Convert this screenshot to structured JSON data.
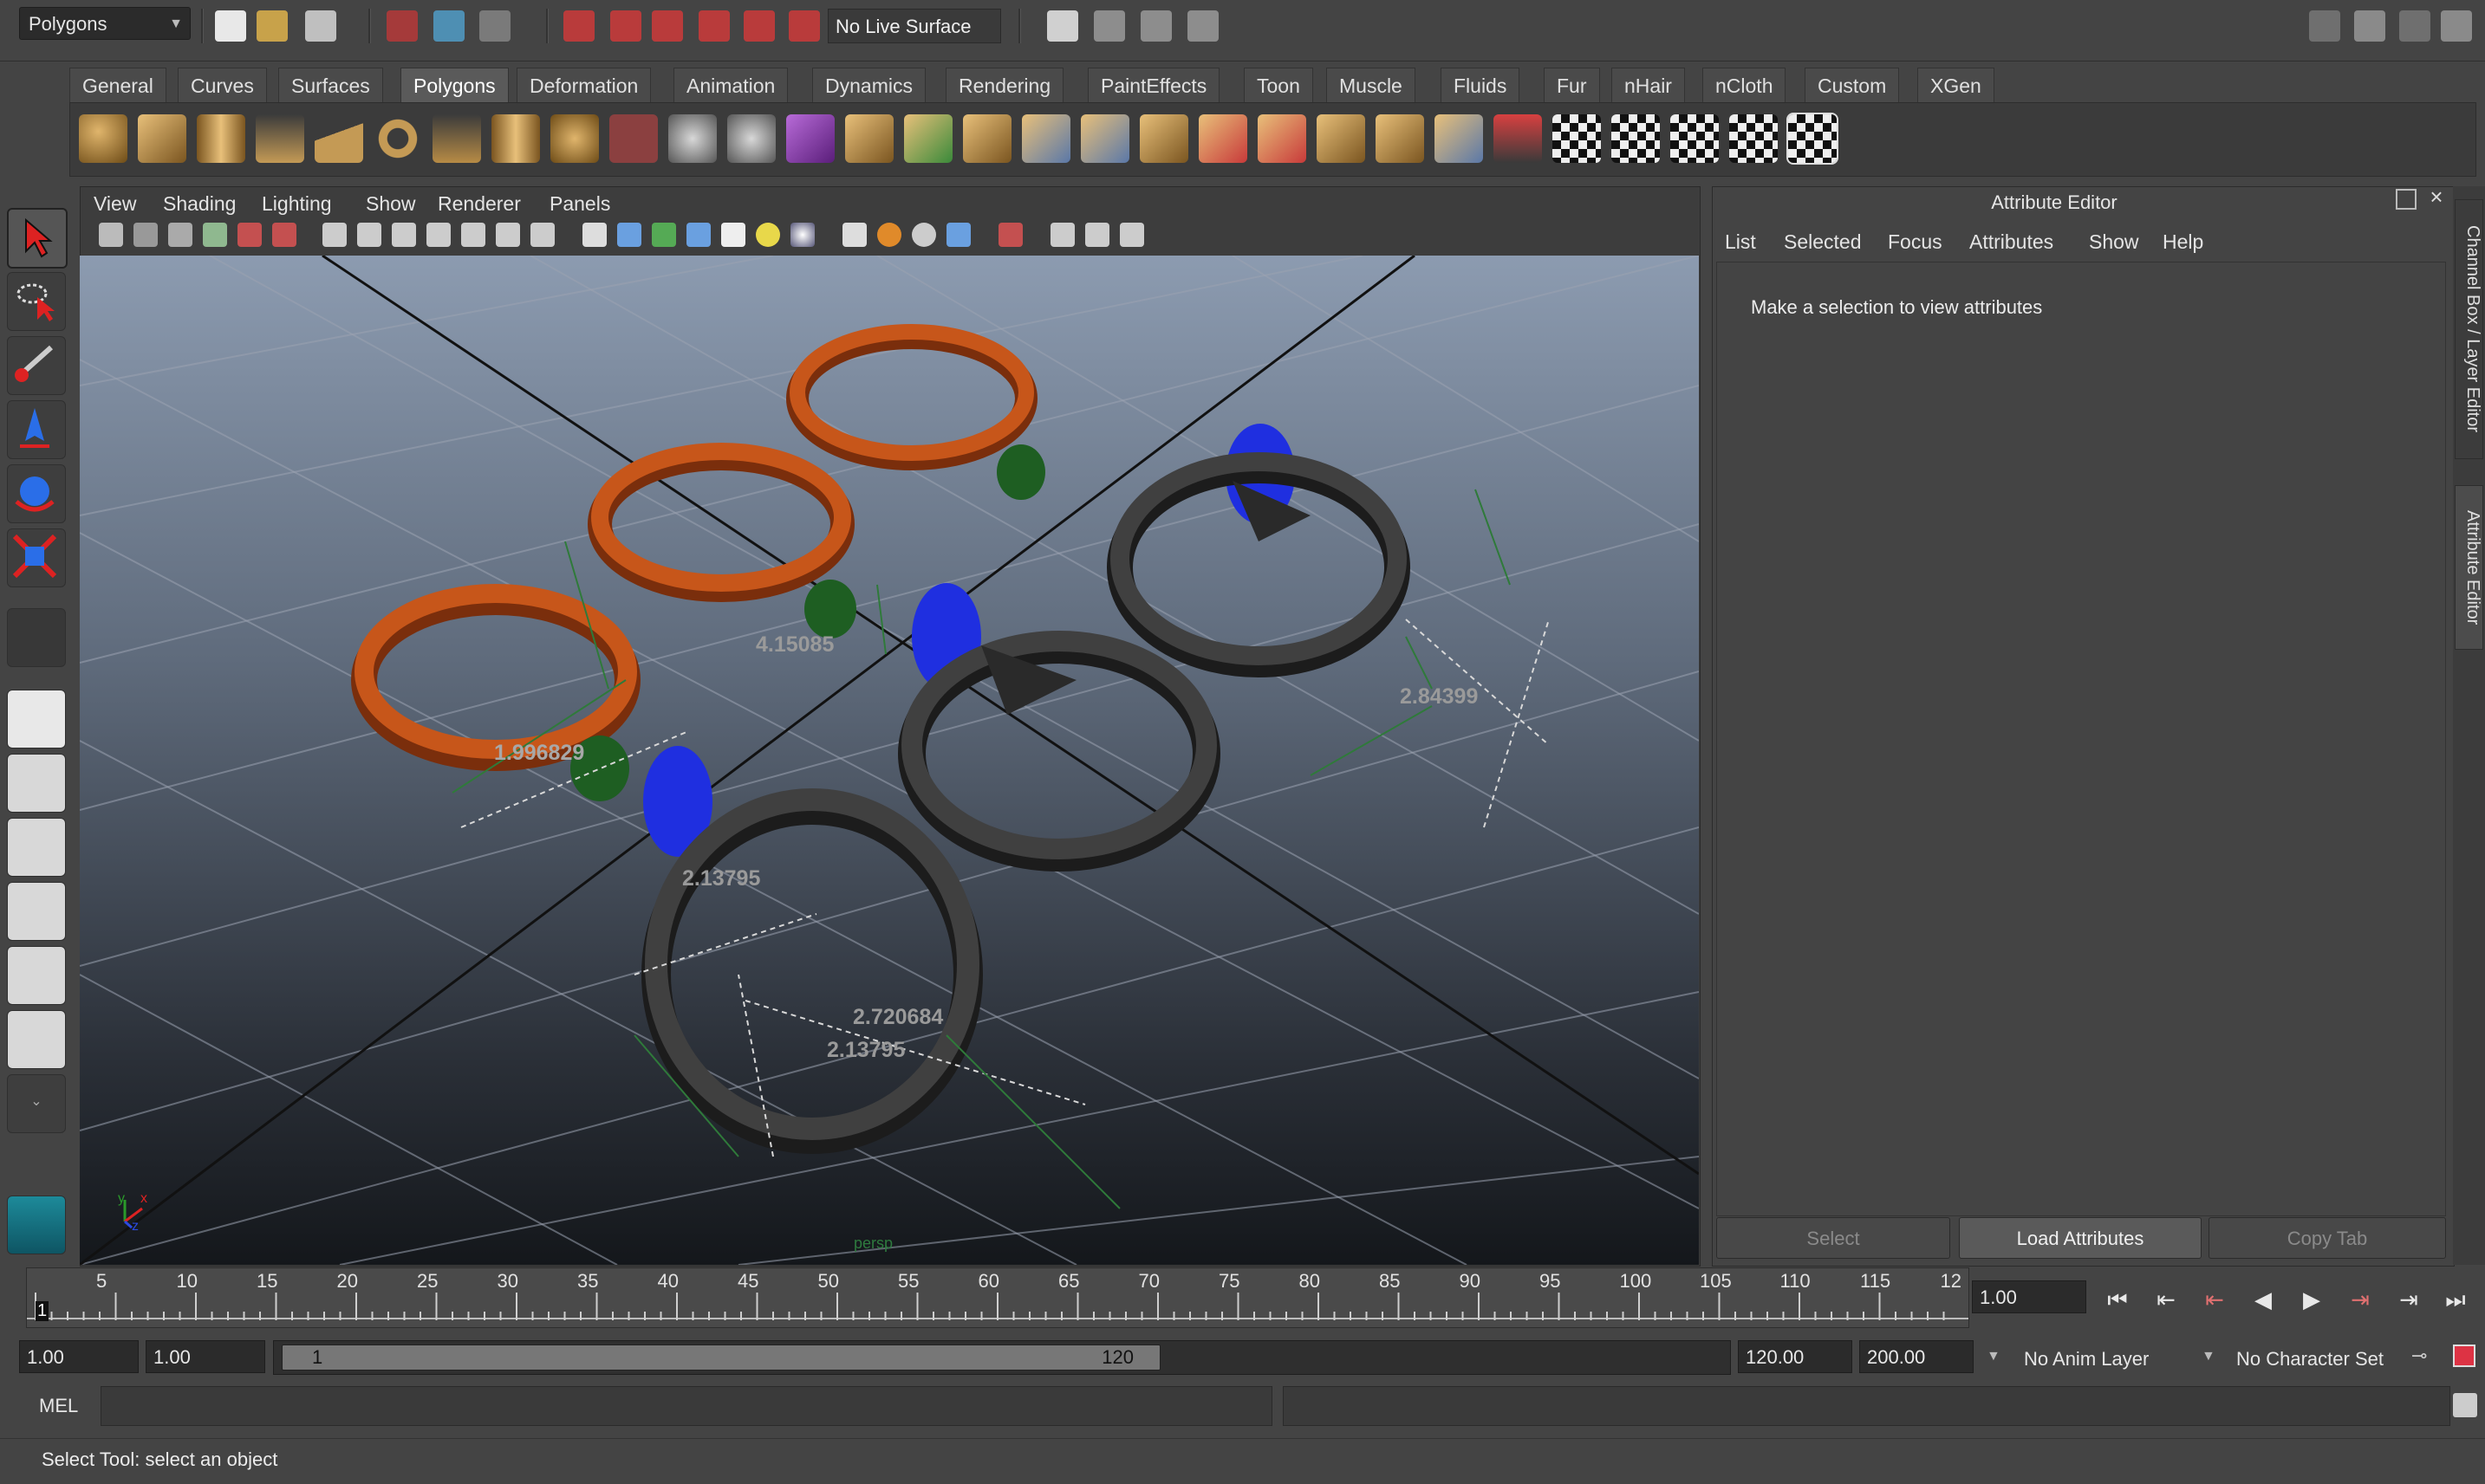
{
  "status_line": {
    "menu_set": "Polygons",
    "live_surface": "No Live Surface"
  },
  "shelf": {
    "tabs": [
      "General",
      "Curves",
      "Surfaces",
      "Polygons",
      "Deformation",
      "Animation",
      "Dynamics",
      "Rendering",
      "PaintEffects",
      "Toon",
      "Muscle",
      "Fluids",
      "Fur",
      "nHair",
      "nCloth",
      "Custom",
      "XGen"
    ],
    "active_tab": "Polygons"
  },
  "viewport": {
    "menu": [
      "View",
      "Shading",
      "Lighting",
      "Show",
      "Renderer",
      "Panels"
    ],
    "camera_label": "persp",
    "measurements": [
      "4.15085",
      "1.996829",
      "2.84399",
      "2.13795",
      "2.720684",
      "2.13795"
    ],
    "axis_labels": {
      "y": "y",
      "x": "x",
      "z": "z"
    }
  },
  "colors": {
    "ring_orange": "#c7561a",
    "ring_dark": "#3a3a3a",
    "gem_green": "#1e5e22",
    "gem_blue": "#1f2fe0"
  },
  "attribute_editor": {
    "title": "Attribute Editor",
    "menu": [
      "List",
      "Selected",
      "Focus",
      "Attributes",
      "Show",
      "Help"
    ],
    "message": "Make a selection to view attributes",
    "buttons": {
      "select": "Select",
      "load": "Load Attributes",
      "copy": "Copy Tab"
    },
    "side_tabs": [
      "Channel Box / Layer Editor",
      "Attribute Editor"
    ]
  },
  "time_slider": {
    "ticks": [
      "5",
      "10",
      "15",
      "20",
      "25",
      "30",
      "35",
      "40",
      "45",
      "50",
      "55",
      "60",
      "65",
      "70",
      "75",
      "80",
      "85",
      "90",
      "95",
      "100",
      "105",
      "110",
      "115",
      "12"
    ],
    "start_marker": "1",
    "current_frame": "1.00"
  },
  "range_slider": {
    "start_time": "1.00",
    "playback_start": "1.00",
    "range_start_label": "1",
    "range_end_label": "120",
    "playback_end": "120.00",
    "end_time": "200.00",
    "anim_layer": "No Anim Layer",
    "character_set": "No Character Set"
  },
  "command_line": {
    "label": "MEL"
  },
  "help_line": {
    "text": "Select Tool: select an object"
  }
}
